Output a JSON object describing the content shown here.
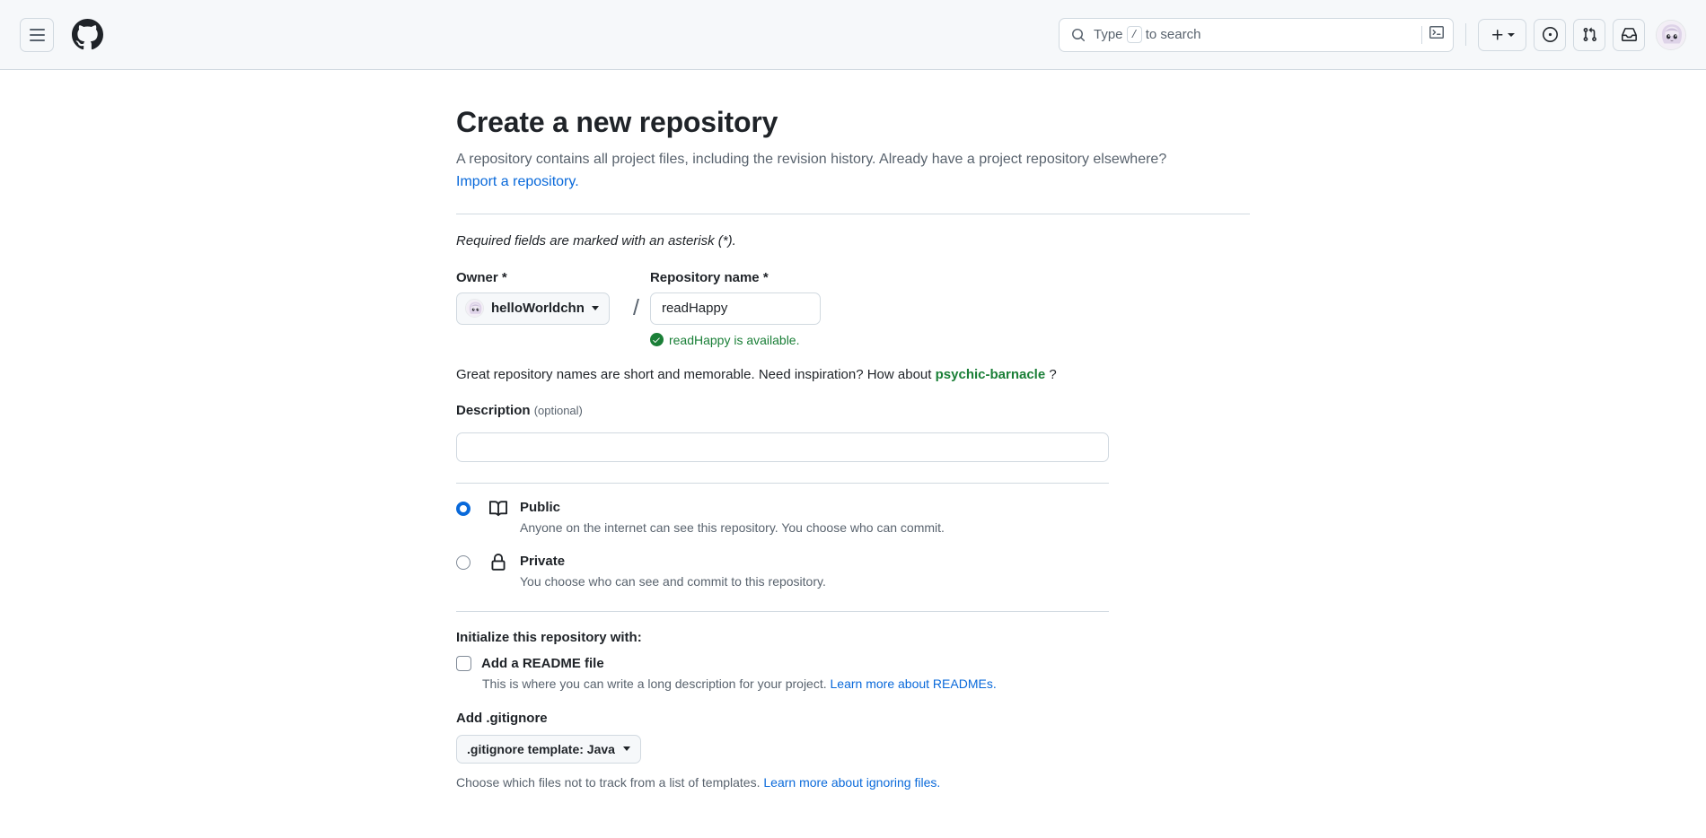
{
  "header": {
    "menu_icon": "hamburger-icon",
    "logo_icon": "github-logo-icon",
    "search": {
      "placeholder_prefix": "Type",
      "kbd": "/",
      "placeholder_suffix": "to search",
      "search_icon": "search-icon",
      "terminal_icon": "terminal-icon"
    },
    "actions": {
      "create_new": "plus-icon",
      "issues": "issue-opened-icon",
      "pull_requests": "git-pull-request-icon",
      "notifications": "inbox-icon",
      "avatar": "user-avatar"
    }
  },
  "main": {
    "title": "Create a new repository",
    "description": "A repository contains all project files, including the revision history. Already have a project repository elsewhere?",
    "import_link": "Import a repository.",
    "required_note": "Required fields are marked with an asterisk (*).",
    "owner": {
      "label": "Owner *",
      "value": "helloWorldchn"
    },
    "repo_name": {
      "label": "Repository name *",
      "value": "readHappy",
      "availability": "readHappy is available.",
      "availability_color": "#1a7f37"
    },
    "separator": "/",
    "hint": {
      "prefix": "Great repository names are short and memorable. Need inspiration? How about",
      "suggestion": "psychic-barnacle",
      "suffix": "?"
    },
    "description_field": {
      "label": "Description",
      "optional": "(optional)",
      "value": ""
    },
    "visibility": {
      "selected": "public",
      "options": [
        {
          "id": "public",
          "title": "Public",
          "subtitle": "Anyone on the internet can see this repository. You choose who can commit.",
          "icon": "repo-icon"
        },
        {
          "id": "private",
          "title": "Private",
          "subtitle": "You choose who can see and commit to this repository.",
          "icon": "lock-icon"
        }
      ]
    },
    "initialize": {
      "title": "Initialize this repository with:",
      "readme": {
        "label": "Add a README file",
        "checked": false,
        "sub_prefix": "This is where you can write a long description for your project.",
        "sub_link": "Learn more about READMEs."
      }
    },
    "gitignore": {
      "title": "Add .gitignore",
      "selected": ".gitignore template: Java",
      "sub_prefix": "Choose which files not to track from a list of templates.",
      "sub_link": "Learn more about ignoring files."
    }
  },
  "colors": {
    "accent": "#0969da",
    "success": "#1a7f37",
    "border": "#d1d9e0",
    "header_bg": "#f6f8fa",
    "text": "#1f2328",
    "muted": "#59636e"
  }
}
